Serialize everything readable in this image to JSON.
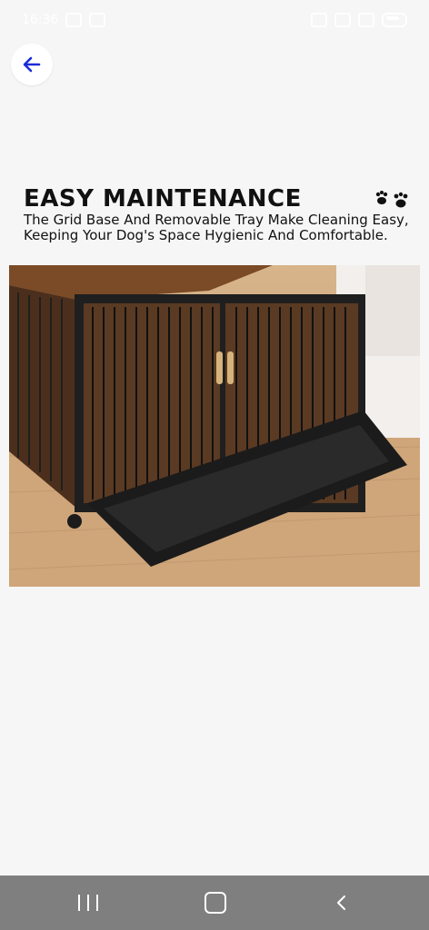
{
  "status": {
    "time": "16:36"
  },
  "banner": {
    "title": "EASY MAINTENANCE",
    "subtitle": "The Grid Base And Removable Tray Make Cleaning Easy, Keeping Your Dog's Space Hygienic And Comfortable."
  },
  "colors": {
    "background": "#f6f6f6",
    "nav_bar": "#7f7f7f",
    "back_icon": "#1a2bd8"
  },
  "icons": {
    "back": "back-arrow-icon",
    "paws": "paw-prints-icon",
    "nav_recent": "recent-apps-icon",
    "nav_home": "home-icon",
    "nav_back": "nav-back-icon"
  }
}
